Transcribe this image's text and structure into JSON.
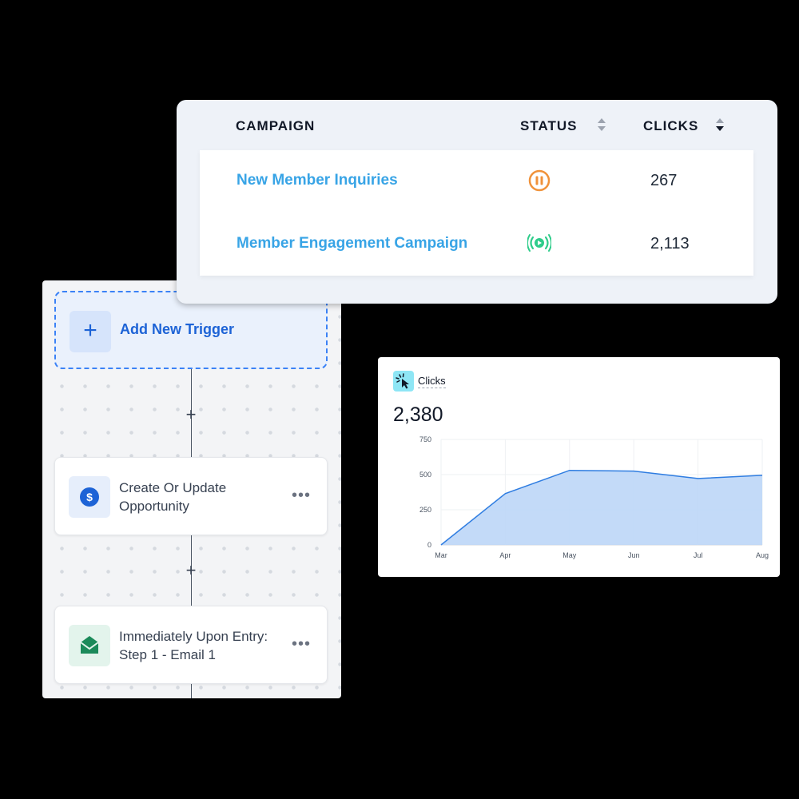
{
  "campaign_table": {
    "headers": {
      "campaign": "CAMPAIGN",
      "status": "STATUS",
      "clicks": "CLICKS"
    },
    "rows": [
      {
        "name": "New Member Inquiries",
        "status": "paused",
        "status_color": "#f0923a",
        "clicks": "267"
      },
      {
        "name": "Member Engagement Campaign",
        "status": "active",
        "status_color": "#2ecc8a",
        "clicks": "2,113"
      }
    ]
  },
  "workflow": {
    "trigger_label": "Add New Trigger",
    "add_icon": "plus-icon",
    "nodes": [
      {
        "line1": "Create Or Update",
        "line2": "Opportunity",
        "icon": "dollar-icon",
        "icon_color": "#1d63d6"
      },
      {
        "line1": "Immediately Upon Entry:",
        "line2": "Step 1 - Email 1",
        "icon": "envelope-open-icon",
        "icon_color": "#1b8a5a"
      }
    ],
    "menu_icon": "more-horizontal-icon"
  },
  "clicks_card": {
    "title": "Clicks",
    "icon": "cursor-click-icon",
    "total": "2,380"
  },
  "chart_data": {
    "type": "area",
    "categories": [
      "Mar",
      "Apr",
      "May",
      "Jun",
      "Jul",
      "Aug"
    ],
    "values": [
      0,
      365,
      530,
      525,
      472,
      495
    ],
    "yticks": [
      "0",
      "250",
      "500",
      "750"
    ],
    "ylim": [
      0,
      750
    ],
    "color": "#2f7de1",
    "fill": "#bcd6f7",
    "grid": true
  }
}
